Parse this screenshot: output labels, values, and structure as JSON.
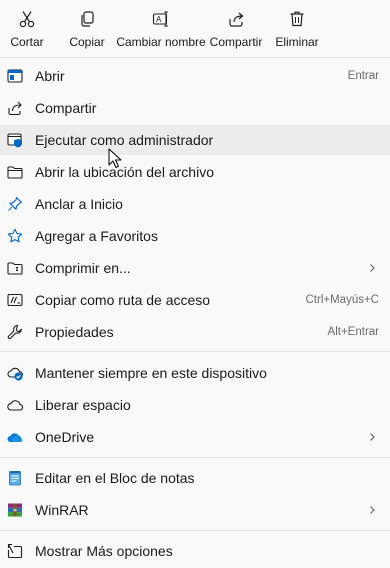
{
  "actions": [
    {
      "label": "Cortar",
      "icon": "scissors-icon"
    },
    {
      "label": "Copiar",
      "icon": "copy-icon"
    },
    {
      "label": "Cambiar nombre",
      "icon": "rename-icon"
    },
    {
      "label": "Compartir",
      "icon": "share-icon"
    },
    {
      "label": "Eliminar",
      "icon": "trash-icon"
    }
  ],
  "items": [
    {
      "label": "Abrir",
      "shortcut": "Entrar",
      "icon": "open-window-icon"
    },
    {
      "label": "Compartir",
      "icon": "share-icon"
    },
    {
      "label": "Ejecutar como administrador",
      "icon": "run-as-admin-shield-icon",
      "hovered": true
    },
    {
      "label": "Abrir la ubicación del archivo",
      "icon": "folder-icon"
    },
    {
      "label": "Anclar a Inicio",
      "icon": "pin-icon"
    },
    {
      "label": "Agregar a Favoritos",
      "icon": "star-icon"
    },
    {
      "label": "Comprimir en...",
      "icon": "zip-folder-icon",
      "submenu": true
    },
    {
      "label": "Copiar como ruta de acceso",
      "shortcut": "Ctrl+Mayús+C",
      "icon": "copy-path-icon"
    },
    {
      "label": "Propiedades",
      "shortcut": "Alt+Entrar",
      "icon": "wrench-icon"
    },
    {
      "label": "Mantener siempre en este dispositivo",
      "icon": "cloud-check-icon"
    },
    {
      "label": "Liberar espacio",
      "icon": "cloud-outline-icon"
    },
    {
      "label": "OneDrive",
      "icon": "onedrive-icon",
      "submenu": true
    },
    {
      "label": "Editar en el Bloc de notas",
      "icon": "notepad-icon"
    },
    {
      "label": "WinRAR",
      "icon": "winrar-icon",
      "submenu": true
    },
    {
      "label": "Mostrar Más opciones",
      "icon": "more-options-icon"
    }
  ],
  "colors": {
    "background": "#f9f9f9",
    "hover": "#ececec",
    "accent": "#0067c0",
    "separator": "#e3e3e3"
  }
}
